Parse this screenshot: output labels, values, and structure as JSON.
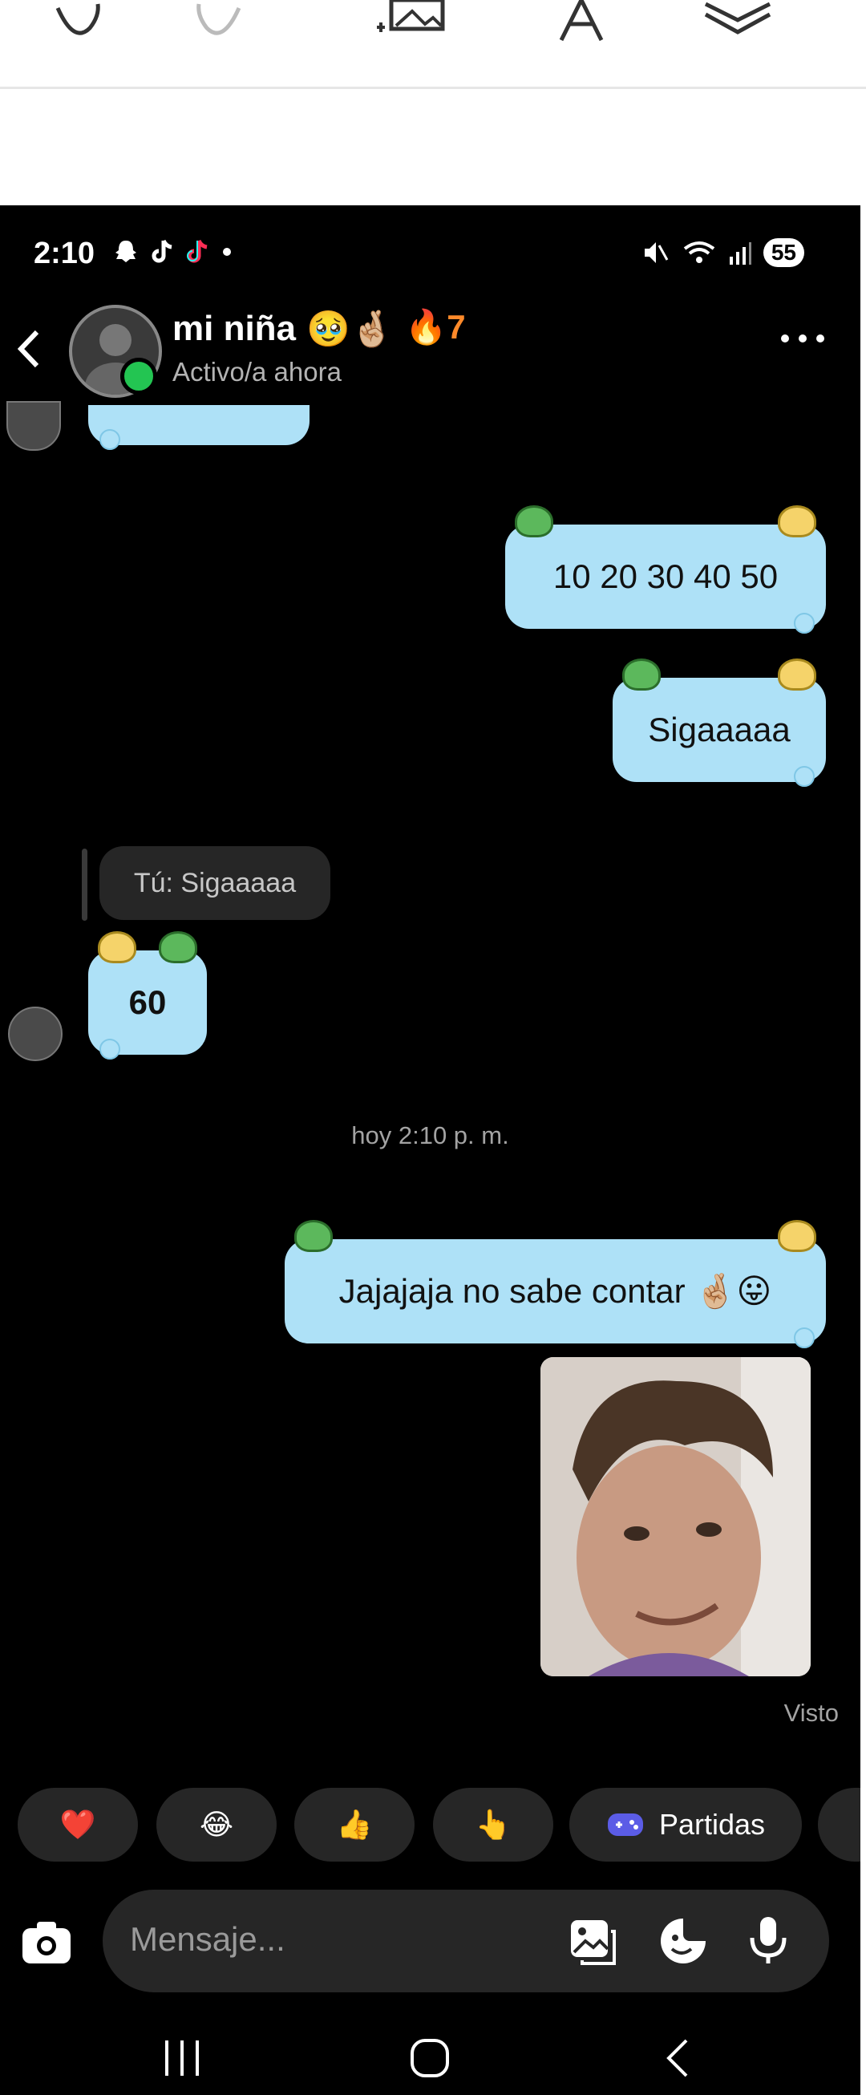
{
  "editor_toolbar": {
    "icons": [
      "undo-icon",
      "redo-icon",
      "add-image-icon",
      "text-style-icon",
      "layers-icon"
    ]
  },
  "status_bar": {
    "time": "2:10",
    "battery": "55"
  },
  "chat_header": {
    "name": "mi niña",
    "name_emojis": "🥹🤞🏼",
    "streak": "🔥7",
    "status": "Activo/a ahora"
  },
  "messages": [
    {
      "side": "sent",
      "text": "10 20 30 40 50"
    },
    {
      "side": "sent",
      "text": "Sigaaaaa"
    },
    {
      "side": "received_reply_ref",
      "text": "Tú: Sigaaaaa"
    },
    {
      "side": "received",
      "text": "60"
    },
    {
      "side": "sent",
      "text": "Jajajaja no sabe contar 🤞🏼😛"
    }
  ],
  "timestamp": "hoy 2:10 p. m.",
  "seen": "Visto",
  "quick_reactions": [
    "❤️",
    "😂",
    "👍",
    "👆",
    "Partidas"
  ],
  "composer": {
    "placeholder": "Mensaje..."
  },
  "colors": {
    "bubble": "#aee1f7",
    "background": "#000000",
    "online": "#23c552",
    "streak": "#ff8a2a",
    "games_icon": "#5b5ce6"
  }
}
